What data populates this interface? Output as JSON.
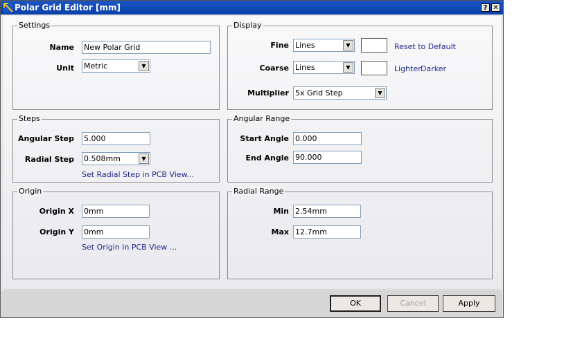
{
  "window": {
    "title": "Polar Grid Editor [mm]",
    "help_label": "?",
    "close_label": "✕"
  },
  "settings": {
    "title": "Settings",
    "name_label": "Name",
    "name_value": "New Polar Grid",
    "unit_label": "Unit",
    "unit_value": "Metric"
  },
  "display": {
    "title": "Display",
    "fine_label": "Fine",
    "fine_value": "Lines",
    "coarse_label": "Coarse",
    "coarse_value": "Lines",
    "multiplier_label": "Multiplier",
    "multiplier_value": "5x Grid Step",
    "reset_link": "Reset to Default",
    "lighter_link": "Lighter",
    "darker_link": "Darker"
  },
  "steps": {
    "title": "Steps",
    "angular_label": "Angular Step",
    "angular_value": "5.000",
    "radial_label": "Radial Step",
    "radial_value": "0.508mm",
    "set_link": "Set Radial Step in PCB View..."
  },
  "angular_range": {
    "title": "Angular Range",
    "start_label": "Start Angle",
    "start_value": "0.000",
    "end_label": "End Angle",
    "end_value": "90.000"
  },
  "origin": {
    "title": "Origin",
    "x_label": "Origin X",
    "x_value": "0mm",
    "y_label": "Origin Y",
    "y_value": "0mm",
    "set_link": "Set Origin in PCB View ..."
  },
  "radial_range": {
    "title": "Radial Range",
    "min_label": "Min",
    "min_value": "2.54mm",
    "max_label": "Max",
    "max_value": "12.7mm"
  },
  "buttons": {
    "ok": "OK",
    "cancel": "Cancel",
    "apply": "Apply"
  },
  "colors": {
    "titlebar": "#0a3fa8",
    "link": "#1d2a8c",
    "field_border": "#7f9db9"
  }
}
